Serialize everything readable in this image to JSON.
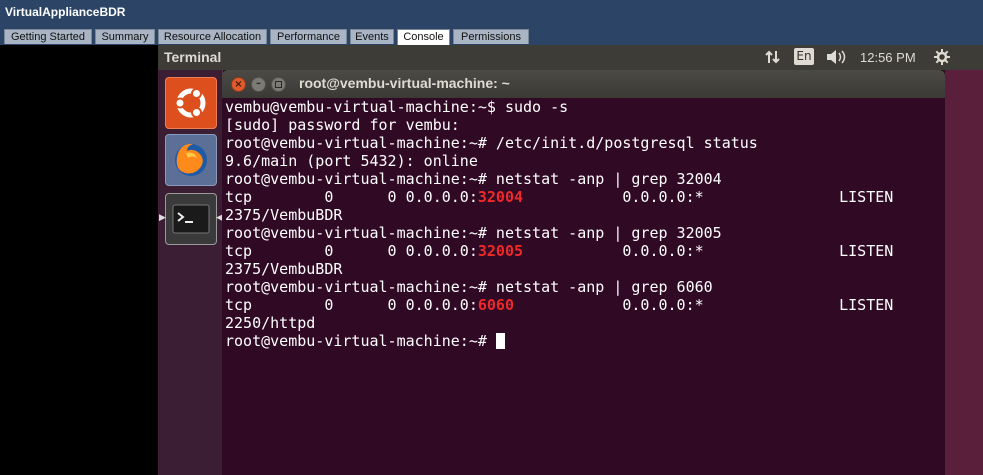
{
  "window": {
    "title": "VirtualApplianceBDR"
  },
  "tabs": [
    {
      "label": "Getting Started",
      "active": false
    },
    {
      "label": "Summary",
      "active": false
    },
    {
      "label": "Resource Allocation",
      "active": false
    },
    {
      "label": "Performance",
      "active": false
    },
    {
      "label": "Events",
      "active": false
    },
    {
      "label": "Console",
      "active": true
    },
    {
      "label": "Permissions",
      "active": false
    }
  ],
  "panel": {
    "app_title": "Terminal",
    "indicators": {
      "network_icon": "network-updown-icon",
      "keyboard_layout": "En",
      "volume_icon": "volume-icon",
      "settings_icon": "gear-icon"
    },
    "clock": "12:56 PM"
  },
  "launcher": {
    "items": [
      {
        "name": "Dash",
        "icon": "ubuntu-logo-icon"
      },
      {
        "name": "Firefox",
        "icon": "firefox-icon"
      },
      {
        "name": "Terminal",
        "icon": "terminal-icon"
      }
    ]
  },
  "terminal": {
    "title": "root@vembu-virtual-machine: ~",
    "lines": [
      "vembu@vembu-virtual-machine:~$ sudo -s",
      "[sudo] password for vembu:",
      "root@vembu-virtual-machine:~# /etc/init.d/postgresql status",
      "9.6/main (port 5432): online",
      "root@vembu-virtual-machine:~# netstat -anp | grep 32004",
      {
        "pre": "tcp        0      0 0.0.0.0:",
        "hl": "32004",
        "post": "           0.0.0.0:*               LISTEN"
      },
      "2375/VembuBDR",
      "root@vembu-virtual-machine:~# netstat -anp | grep 32005",
      {
        "pre": "tcp        0      0 0.0.0.0:",
        "hl": "32005",
        "post": "           0.0.0.0:*               LISTEN"
      },
      "2375/VembuBDR",
      "root@vembu-virtual-machine:~# netstat -anp | grep 6060",
      {
        "pre": "tcp        0      0 0.0.0.0:",
        "hl": "6060",
        "post": "            0.0.0.0:*               LISTEN"
      },
      "2250/httpd",
      "root@vembu-virtual-machine:~# "
    ],
    "colors": {
      "background": "#300a24",
      "foreground": "#ffffff",
      "highlight": "#ef2929"
    }
  }
}
